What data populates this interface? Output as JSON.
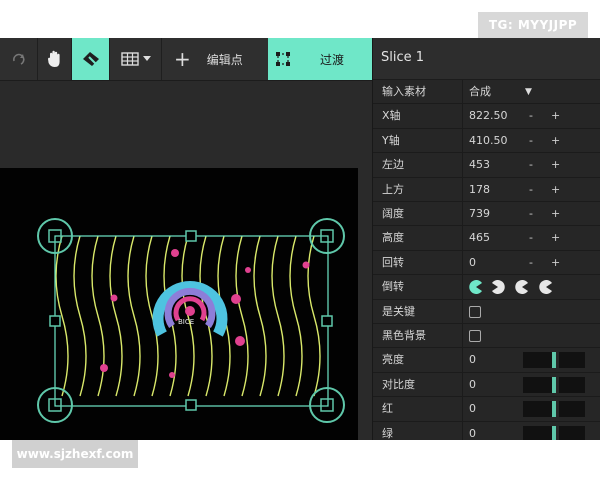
{
  "toolbar": {
    "add_point_label": "编辑点",
    "transition_label": "过渡"
  },
  "panel": {
    "title": "Slice 1",
    "rows": [
      {
        "label": "输入素材",
        "value": "合成"
      },
      {
        "label": "X轴",
        "value": "822.50"
      },
      {
        "label": "Y轴",
        "value": "410.50"
      },
      {
        "label": "左边",
        "value": "453"
      },
      {
        "label": "上方",
        "value": "178"
      },
      {
        "label": "阔度",
        "value": "739"
      },
      {
        "label": "高度",
        "value": "465"
      },
      {
        "label": "回转",
        "value": "0"
      },
      {
        "label": "倒转",
        "value": ""
      },
      {
        "label": "是关键",
        "value": ""
      },
      {
        "label": "黑色背景",
        "value": ""
      },
      {
        "label": "亮度",
        "value": "0"
      },
      {
        "label": "对比度",
        "value": "0"
      },
      {
        "label": "红",
        "value": "0"
      },
      {
        "label": "绿",
        "value": "0"
      }
    ],
    "stepper_minus": "-",
    "stepper_plus": "+"
  },
  "watermarks": {
    "top": "TG: MYYJJPP",
    "bottom": "www.sjzhexf.com"
  },
  "colors": {
    "accent": "#6fe7c8",
    "handle": "#5fc8aa",
    "wave": "#d9e86a",
    "arc_blue": "#4ec3e0",
    "arc_pink": "#e0418f"
  },
  "icons": [
    "redo-icon",
    "hand-icon",
    "pick-icon",
    "grid-icon",
    "chevron-down-icon",
    "plus-icon",
    "transform-icon"
  ]
}
